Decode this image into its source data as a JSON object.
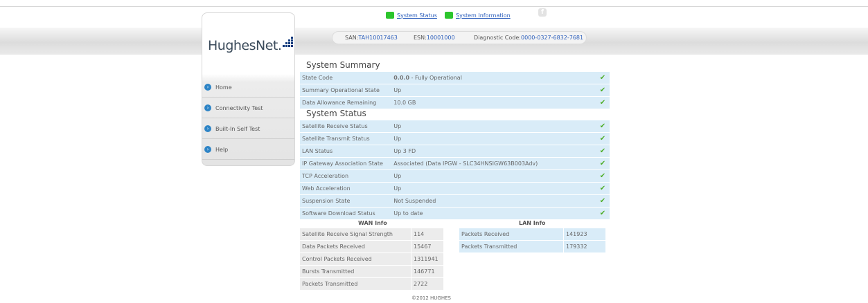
{
  "top_links": [
    {
      "label": "System Status"
    },
    {
      "label": "System Information"
    }
  ],
  "logo": {
    "text": "HughesNet",
    "mark": "."
  },
  "info_bar": {
    "san_label": "SAN:",
    "san_value": "TAH10017463",
    "esn_label": "ESN:",
    "esn_value": "10001000",
    "diag_label": "Diagnostic Code:",
    "diag_value": "0000-0327-6832-7681"
  },
  "sidebar": {
    "items": [
      {
        "label": "Home"
      },
      {
        "label": "Connectivity Test"
      },
      {
        "label": "Built-In Self Test"
      },
      {
        "label": "Help"
      }
    ]
  },
  "system_summary": {
    "title": "System Summary",
    "rows": [
      {
        "label": "State Code",
        "code": "0.0.0",
        "value": " - Fully Operational"
      },
      {
        "label": "Summary Operational State",
        "code": "",
        "value": "Up"
      },
      {
        "label": "Data Allowance Remaining",
        "code": "",
        "value": "10.0 GB"
      }
    ]
  },
  "system_status": {
    "title": "System Status",
    "rows": [
      {
        "label": "Satellite Receive Status",
        "value": "Up"
      },
      {
        "label": "Satellite Transmit Status",
        "value": "Up"
      },
      {
        "label": "LAN Status",
        "value": "Up 3 FD"
      },
      {
        "label": "IP Gateway Association State",
        "value": "Associated (Data IPGW - SLC34HNSIGW63B003Adv)"
      },
      {
        "label": "TCP Acceleration",
        "value": "Up"
      },
      {
        "label": "Web Acceleration",
        "value": "Up"
      },
      {
        "label": "Suspension State",
        "value": "Not Suspended"
      },
      {
        "label": "Software Download Status",
        "value": "Up to date"
      }
    ]
  },
  "wan_info": {
    "title": "WAN Info",
    "rows": [
      {
        "label": "Satellite Receive Signal Strength",
        "value": "114"
      },
      {
        "label": "Data Packets Received",
        "value": "15467"
      },
      {
        "label": "Control Packets Received",
        "value": "1311941"
      },
      {
        "label": "Bursts Transmitted",
        "value": "146771"
      },
      {
        "label": "Packets Transmitted",
        "value": "2722"
      }
    ]
  },
  "lan_info": {
    "title": "LAN Info",
    "rows": [
      {
        "label": "Packets Received",
        "value": "141923"
      },
      {
        "label": "Packets Transmitted",
        "value": "179332"
      }
    ]
  },
  "footer": {
    "text": "©2012 HUGHES"
  },
  "check_glyph": "✔",
  "colors": {
    "row_bg": "#d9ecf8",
    "wan_bg": "#ececec",
    "check": "#4fae2a",
    "link": "#2a5dbb",
    "status_icon": "#2cc52c",
    "nav_bullet": "#2d84c6"
  },
  "icons": {
    "status": "green-square-icon",
    "facebook": "facebook-icon",
    "nav": "nav-arrow-icon",
    "ok": "checkmark-icon"
  }
}
